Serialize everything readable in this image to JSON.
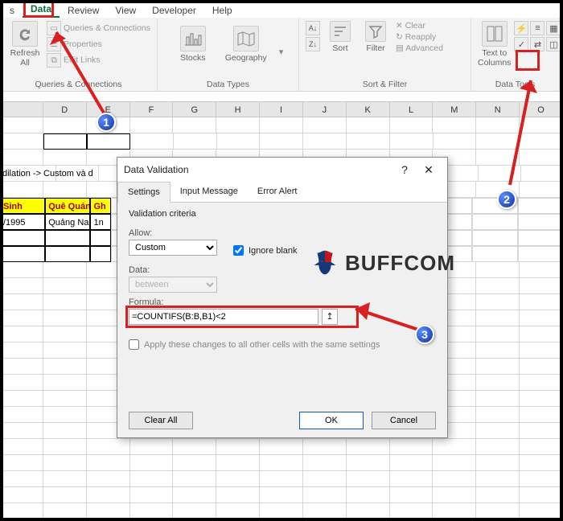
{
  "tabs": {
    "first": "s",
    "data": "Data",
    "review": "Review",
    "view": "View",
    "developer": "Developer",
    "help": "Help"
  },
  "ribbon": {
    "refresh": "Refresh\nAll",
    "qc": {
      "a": "Queries & Connections",
      "b": "Properties",
      "c": "Edit Links",
      "group": "Queries & Connections"
    },
    "dt": {
      "stocks": "Stocks",
      "geo": "Geography",
      "group": "Data Types"
    },
    "sf": {
      "sort": "Sort",
      "filter": "Filter",
      "clear": "Clear",
      "reapply": "Reapply",
      "adv": "Advanced",
      "group": "Sort & Filter"
    },
    "tools": {
      "ttc": "Text to\nColumns",
      "group": "Data Tools"
    }
  },
  "columns": [
    "",
    "D",
    "E",
    "F",
    "G",
    "H",
    "I",
    "J",
    "K",
    "L",
    "M",
    "N",
    "O"
  ],
  "cells": {
    "r6d": "dilation -> Custom và d",
    "h_sinh": "Sinh",
    "h_que": "Quê Quán",
    "h_gh": "Gh",
    "d_date": "/1995",
    "d_que": "Quảng Nam",
    "d_gh": "1n"
  },
  "dialog": {
    "title": "Data Validation",
    "tabs": {
      "settings": "Settings",
      "input": "Input Message",
      "error": "Error Alert"
    },
    "criteria_label": "Validation criteria",
    "allow_label": "Allow:",
    "allow_value": "Custom",
    "ignore_blank": "Ignore blank",
    "data_label": "Data:",
    "data_value": "between",
    "formula_label": "Formula:",
    "formula_value": "=COUNTIFS(B:B,B1)<2",
    "apply_same": "Apply these changes to all other cells with the same settings",
    "clear": "Clear All",
    "ok": "OK",
    "cancel": "Cancel"
  },
  "badges": {
    "one": "1",
    "two": "2",
    "three": "3"
  },
  "watermark": "BUFFCOM"
}
